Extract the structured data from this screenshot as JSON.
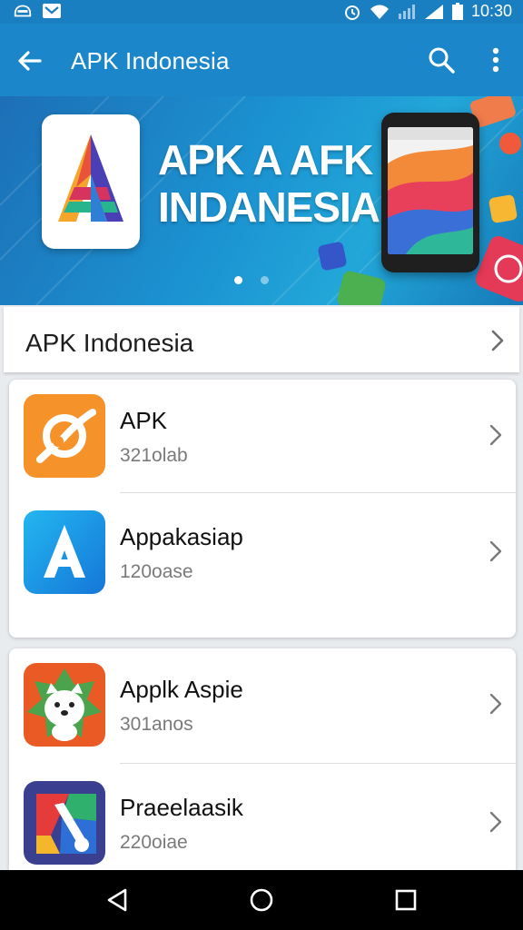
{
  "status_bar": {
    "time": "10:30",
    "icons": [
      "gamepad-icon",
      "mail-icon",
      "alarm-icon",
      "wifi-icon",
      "signal-icon",
      "battery-icon"
    ]
  },
  "app_bar": {
    "title": "APK Indonesia",
    "icons": [
      "back-arrow-icon",
      "search-icon",
      "more-vert-icon"
    ]
  },
  "banner": {
    "headline_line1": "APK A AFK",
    "headline_line2": "INDANESIA",
    "page_indicator": {
      "count": 2,
      "active": 0
    }
  },
  "section": {
    "title": "APK Indonesia"
  },
  "cards": [
    {
      "items": [
        {
          "name": "APK",
          "subtitle": "321olab",
          "icon": "orange-brush-icon"
        },
        {
          "name": "Appakasiap",
          "subtitle": "120oase",
          "icon": "blue-a-icon"
        }
      ]
    },
    {
      "items": [
        {
          "name": "Applk Aspie",
          "subtitle": "301anos",
          "icon": "dog-sticker-icon"
        },
        {
          "name": "Praeelaasik",
          "subtitle": "220oiae",
          "icon": "colorful-tool-icon"
        }
      ]
    }
  ],
  "colors": {
    "status_bar": "#1a7fc0",
    "app_bar": "#1b86c9",
    "nav_bar": "#000000"
  }
}
